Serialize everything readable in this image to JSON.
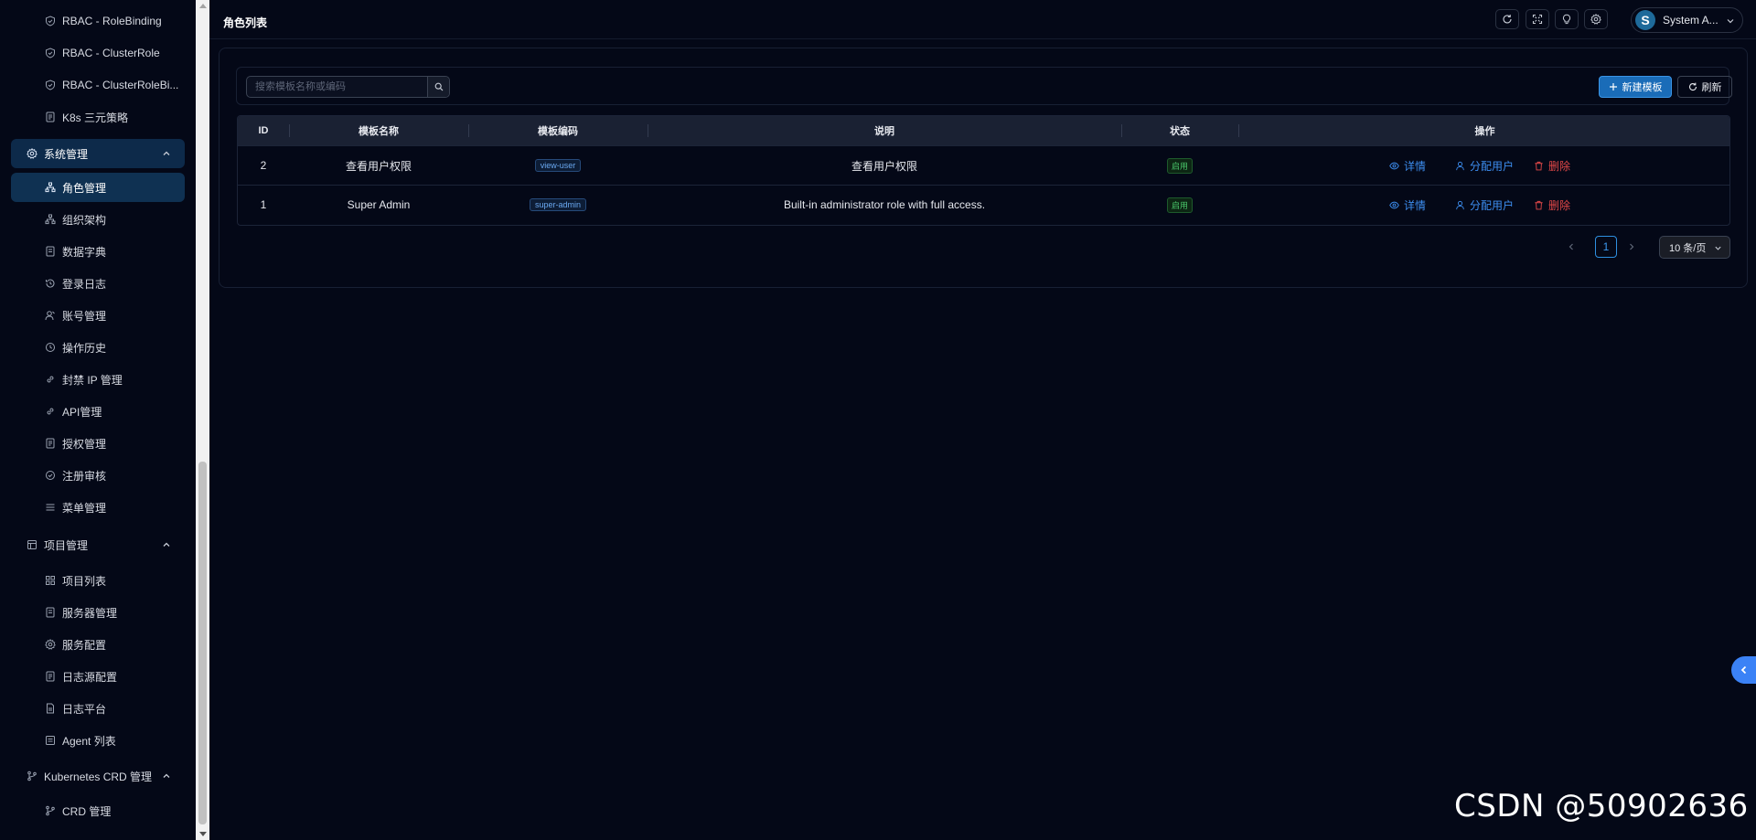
{
  "sidebar": {
    "items": [
      {
        "label": "RBAC - RoleBinding",
        "icon": "shield-icon"
      },
      {
        "label": "RBAC - ClusterRole",
        "icon": "shield-icon"
      },
      {
        "label": "RBAC - ClusterRoleBi...",
        "icon": "shield-icon"
      },
      {
        "label": "K8s 三元策略",
        "icon": "document-icon"
      }
    ],
    "groups": [
      {
        "label": "系统管理",
        "icon": "gear-icon",
        "expanded": true,
        "active": true,
        "children": [
          {
            "label": "角色管理",
            "icon": "org-icon",
            "active": true
          },
          {
            "label": "组织架构",
            "icon": "org-icon"
          },
          {
            "label": "数据字典",
            "icon": "book-icon"
          },
          {
            "label": "登录日志",
            "icon": "history-icon"
          },
          {
            "label": "账号管理",
            "icon": "user-icon"
          },
          {
            "label": "操作历史",
            "icon": "clock-icon"
          },
          {
            "label": "封禁 IP 管理",
            "icon": "link-icon"
          },
          {
            "label": "API管理",
            "icon": "link-icon"
          },
          {
            "label": "授权管理",
            "icon": "document-icon"
          },
          {
            "label": "注册审核",
            "icon": "check-circle-icon"
          },
          {
            "label": "菜单管理",
            "icon": "menu-icon"
          }
        ]
      },
      {
        "label": "项目管理",
        "icon": "project-icon",
        "expanded": true,
        "children": [
          {
            "label": "项目列表",
            "icon": "grid-icon"
          },
          {
            "label": "服务器管理",
            "icon": "book-icon"
          },
          {
            "label": "服务配置",
            "icon": "gear-icon"
          },
          {
            "label": "日志源配置",
            "icon": "document-icon"
          },
          {
            "label": "日志平台",
            "icon": "file-icon"
          },
          {
            "label": "Agent 列表",
            "icon": "monitor-icon"
          }
        ]
      },
      {
        "label": "Kubernetes CRD 管理",
        "icon": "branch-icon",
        "expanded": true,
        "children": [
          {
            "label": "CRD 管理",
            "icon": "branch-icon"
          }
        ]
      }
    ]
  },
  "header": {
    "title": "角色列表",
    "buttons": [
      "refresh-icon",
      "fullscreen-icon",
      "bulb-icon",
      "gear-icon"
    ],
    "user": {
      "avatar_letter": "S",
      "name": "System A..."
    }
  },
  "toolbar": {
    "search_placeholder": "搜索模板名称或编码",
    "add_label": "新建模板",
    "refresh_label": "刷新"
  },
  "table": {
    "columns": [
      "ID",
      "模板名称",
      "模板编码",
      "说明",
      "状态",
      "操作"
    ],
    "rows": [
      {
        "id": "2",
        "name": "查看用户权限",
        "code": "view-user",
        "description": "查看用户权限",
        "status": "启用"
      },
      {
        "id": "1",
        "name": "Super Admin",
        "code": "super-admin",
        "description": "Built-in administrator role with full access.",
        "status": "启用"
      }
    ],
    "actions": {
      "detail": "详情",
      "assign": "分配用户",
      "delete": "删除"
    }
  },
  "pagination": {
    "current_page": "1",
    "page_size": "10 条/页"
  },
  "watermark": "CSDN @50902636",
  "colors": {
    "background": "#040817",
    "accent": "#1a6cb8",
    "link": "#3d8ef0",
    "danger": "#e24848",
    "success": "#49c56a"
  }
}
